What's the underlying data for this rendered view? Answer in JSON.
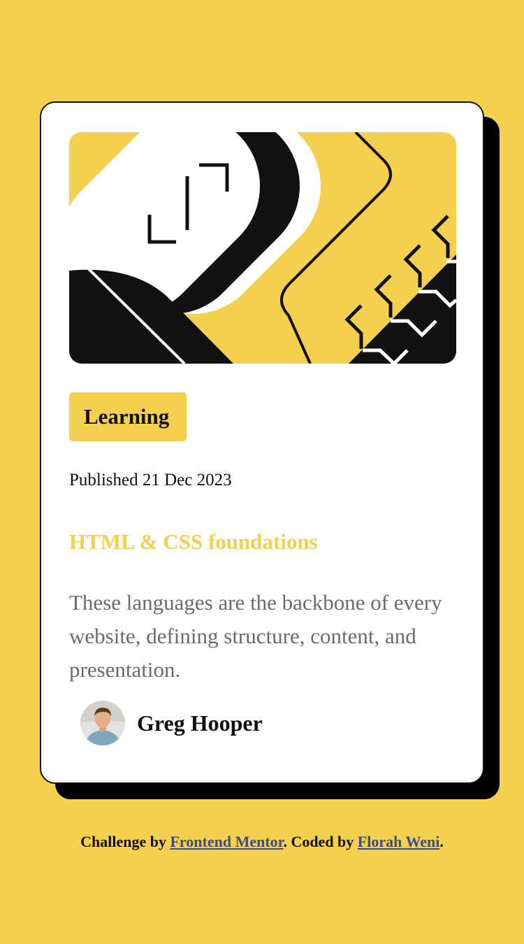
{
  "colors": {
    "background": "#f4d04e",
    "card": "#ffffff",
    "ink": "#111111",
    "muted": "#6b6b6b",
    "link": "#3d4b8c"
  },
  "card": {
    "illustration_icon": "abstract-code-illustration",
    "tag": "Learning",
    "published": "Published 21 Dec 2023",
    "title": "HTML & CSS foundations",
    "description": "These languages are the backbone of every website, defining structure, content, and presentation.",
    "author": {
      "avatar_icon": "person-avatar",
      "name": "Greg Hooper"
    }
  },
  "footer": {
    "prefix": "Challenge by ",
    "link1": "Frontend Mentor",
    "middle": ". Coded by ",
    "link2": "Florah Weni",
    "suffix": "."
  }
}
